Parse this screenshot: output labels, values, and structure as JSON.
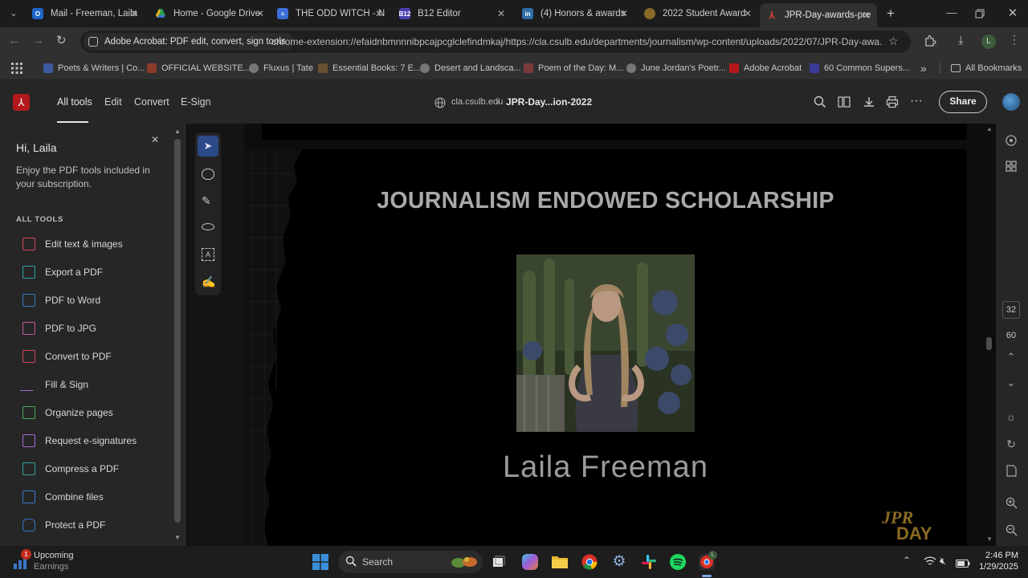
{
  "browser": {
    "tabs": [
      {
        "label": "Mail - Freeman, Laila",
        "icon": "outlook-icon",
        "color": "#1e66c9"
      },
      {
        "label": "Home - Google Drive",
        "icon": "google-drive-icon",
        "color": "#2a9d4a"
      },
      {
        "label": "THE ODD WITCH - N",
        "icon": "docs-icon",
        "color": "#3b6fd8"
      },
      {
        "label": "B12 Editor",
        "icon": "b12-icon",
        "color": "#4a3fb0"
      },
      {
        "label": "(4) Honors & awards",
        "icon": "linkedin-icon",
        "color": "#2f6ea8"
      },
      {
        "label": "2022 Student Award",
        "icon": "award-icon",
        "color": "#8a6a2a"
      },
      {
        "label": "JPR-Day-awards-pre",
        "icon": "acrobat-icon",
        "color": "#b3191c"
      }
    ],
    "site_chip": "Adobe Acrobat: PDF edit, convert, sign tools",
    "url": "chrome-extension://efaidnbmnnnibpcajpcglclefindmkaj/https://cla.csulb.edu/departments/journalism/wp-content/uploads/2022/07/JPR-Day-awa...",
    "profile_initial": "L",
    "bookmarks": [
      {
        "label": "Poets & Writers | Co...",
        "color": "#3d5a9e"
      },
      {
        "label": "OFFICIAL WEBSITE...",
        "color": "#8a3a2a"
      },
      {
        "label": "Fluxus | Tate",
        "color": "#777777"
      },
      {
        "label": "Essential Books: 7 E...",
        "color": "#6a5030"
      },
      {
        "label": "Desert and Landsca...",
        "color": "#777777"
      },
      {
        "label": "Poem of the Day: M...",
        "color": "#7a3a3a"
      },
      {
        "label": "June Jordan's Poetr...",
        "color": "#777777"
      },
      {
        "label": "Adobe Acrobat",
        "color": "#b3191c"
      },
      {
        "label": "60 Common Supers...",
        "color": "#3a3a9a"
      }
    ],
    "all_bookmarks": "All Bookmarks",
    "overflow": "»"
  },
  "acrobat": {
    "nav": {
      "all_tools": "All tools",
      "edit": "Edit",
      "convert": "Convert",
      "esign": "E-Sign"
    },
    "breadcrumb_domain": "cla.csulb.edu",
    "breadcrumb_sep": "/",
    "file_name": "JPR-Day...ion-2022",
    "share": "Share"
  },
  "panel": {
    "greeting": "Hi, Laila",
    "subtitle": "Enjoy the PDF tools included in your subscription.",
    "section": "ALL TOOLS",
    "tools": [
      {
        "label": "Edit text & images",
        "icon": "edit-text-icon",
        "color": "#d2495c"
      },
      {
        "label": "Export a PDF",
        "icon": "export-pdf-icon",
        "color": "#2fa4a4"
      },
      {
        "label": "PDF to Word",
        "icon": "pdf-to-word-icon",
        "color": "#3a78c8"
      },
      {
        "label": "PDF to JPG",
        "icon": "pdf-to-jpg-icon",
        "color": "#c85a9a"
      },
      {
        "label": "Convert to PDF",
        "icon": "convert-pdf-icon",
        "color": "#d2495c"
      },
      {
        "label": "Fill & Sign",
        "icon": "fill-sign-icon",
        "color": "#a66bd6"
      },
      {
        "label": "Organize pages",
        "icon": "organize-pages-icon",
        "color": "#4caa5a"
      },
      {
        "label": "Request e-signatures",
        "icon": "request-esign-icon",
        "color": "#a66bd6"
      },
      {
        "label": "Compress a PDF",
        "icon": "compress-pdf-icon",
        "color": "#2fa4a4"
      },
      {
        "label": "Combine files",
        "icon": "combine-files-icon",
        "color": "#3a78c8"
      },
      {
        "label": "Protect a PDF",
        "icon": "protect-pdf-icon",
        "color": "#3a78c8"
      }
    ]
  },
  "document": {
    "heading": "JOURNALISM ENDOWED SCHOLARSHIP",
    "name": "Laila Freeman",
    "logo_text": "JPR DAY"
  },
  "right_bar": {
    "page_number": "32",
    "page_total": "60"
  },
  "taskbar": {
    "widget_title": "Upcoming",
    "widget_sub": "Earnings",
    "widget_badge": "1",
    "search": "Search",
    "time": "2:46 PM",
    "date": "1/29/2025",
    "chrome_badge": "L"
  }
}
